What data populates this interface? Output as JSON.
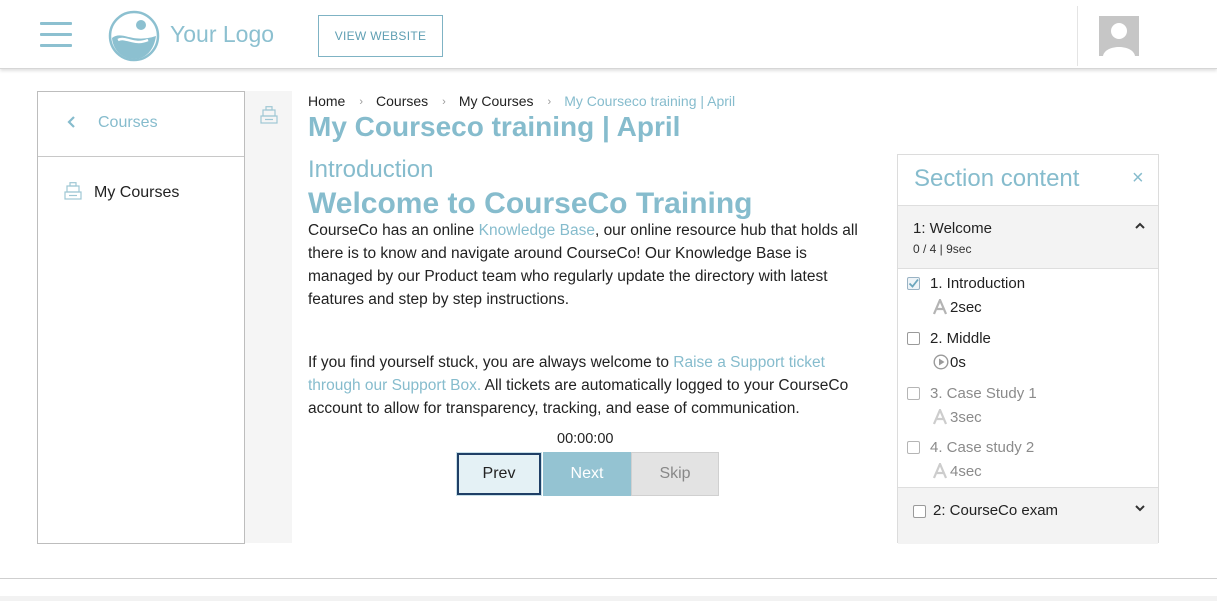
{
  "header": {
    "logo_text": "Your Logo",
    "view_website": "VIEW WEBSITE",
    "accent_color": "#86bccd"
  },
  "leftnav": {
    "back_label": "Courses",
    "items": [
      {
        "label": "My Courses",
        "icon": "courses-icon"
      }
    ]
  },
  "breadcrumb": [
    "Home",
    "Courses",
    "My Courses",
    "My Courseco training | April"
  ],
  "page_title": "My Courseco training | April",
  "section_heading": "Introduction",
  "content": {
    "heading": "Welcome to CourseCo Training",
    "p1_before": "CourseCo has an online ",
    "p1_link": "Knowledge Base",
    "p1_after": ", our online resource hub that holds all there is to know and navigate around CourseCo! Our Knowledge Base is managed by our Product team who regularly update the directory with latest features and step by step instructions.",
    "p2_before": "If you find yourself stuck, you are always welcome to ",
    "p2_link": "Raise a Support ticket through our Support Box.",
    "p2_after": " All tickets are automatically logged to your CourseCo account to allow for transparency, tracking, and ease of communication."
  },
  "player": {
    "timer": "00:00:00",
    "prev": "Prev",
    "next": "Next",
    "skip": "Skip"
  },
  "panel": {
    "title": "Section content",
    "close": "×",
    "section1": {
      "title": "1: Welcome",
      "meta": "0 / 4 | 9sec",
      "activities": [
        {
          "name": "1. Introduction",
          "time": "2sec",
          "icon": "text-icon",
          "checked": true
        },
        {
          "name": "2. Middle",
          "time": "0s",
          "icon": "video-icon",
          "checked": false
        },
        {
          "name": "3. Case Study 1",
          "time": "3sec",
          "icon": "text-icon",
          "checked": false
        },
        {
          "name": "4. Case study 2",
          "time": "4sec",
          "icon": "text-icon",
          "checked": false
        }
      ]
    },
    "section2": {
      "title": "2: CourseCo exam"
    }
  }
}
